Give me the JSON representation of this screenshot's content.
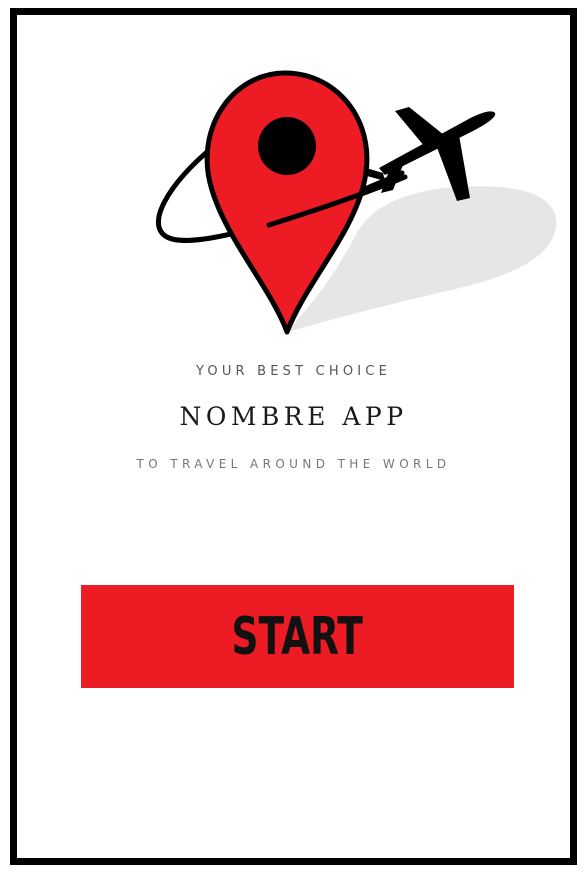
{
  "splash": {
    "tagline_top": "YOUR BEST CHOICE",
    "app_name": "NOMBRE APP",
    "tagline_bottom": "TO TRAVEL AROUND THE WORLD"
  },
  "start_button": {
    "label": "START"
  },
  "logo": {
    "icons": [
      "map-pin-icon",
      "airplane-icon"
    ]
  },
  "colors": {
    "accent": "#ed1c24",
    "frame_border": "#000000",
    "background": "#ffffff",
    "shadow": "#e6e6e6"
  }
}
